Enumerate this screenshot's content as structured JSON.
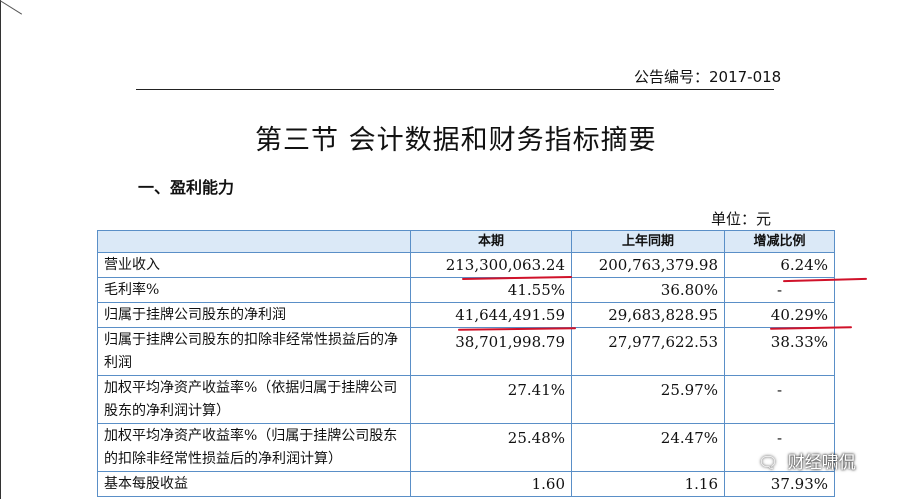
{
  "notice": "公告编号：2017-018",
  "title": "第三节  会计数据和财务指标摘要",
  "section_title": "一、盈利能力",
  "unit": "单位：元",
  "table": {
    "headers": [
      "",
      "本期",
      "上年同期",
      "增减比例"
    ],
    "rows": [
      {
        "item": "营业收入",
        "current": "213,300,063.24",
        "previous": "200,763,379.98",
        "change": "6.24%"
      },
      {
        "item": "毛利率%",
        "current": "41.55%",
        "previous": "36.80%",
        "change": "-"
      },
      {
        "item": "归属于挂牌公司股东的净利润",
        "current": "41,644,491.59",
        "previous": "29,683,828.95",
        "change": "40.29%"
      },
      {
        "item": "归属于挂牌公司股东的扣除非经常性损益后的净利润",
        "current": "38,701,998.79",
        "previous": "27,977,622.53",
        "change": "38.33%"
      },
      {
        "item": "加权平均净资产收益率%（依据归属于挂牌公司股东的净利润计算）",
        "current": "27.41%",
        "previous": "25.97%",
        "change": "-"
      },
      {
        "item": "加权平均净资产收益率%（归属于挂牌公司股东的扣除非经常性损益后的净利润计算）",
        "current": "25.48%",
        "previous": "24.47%",
        "change": "-"
      },
      {
        "item": "基本每股收益",
        "current": "1.60",
        "previous": "1.16",
        "change": "37.93%"
      }
    ]
  },
  "watermark": {
    "icon": "wechat-icon",
    "text": "财经啸侃"
  },
  "highlight_color": "#d0122a"
}
